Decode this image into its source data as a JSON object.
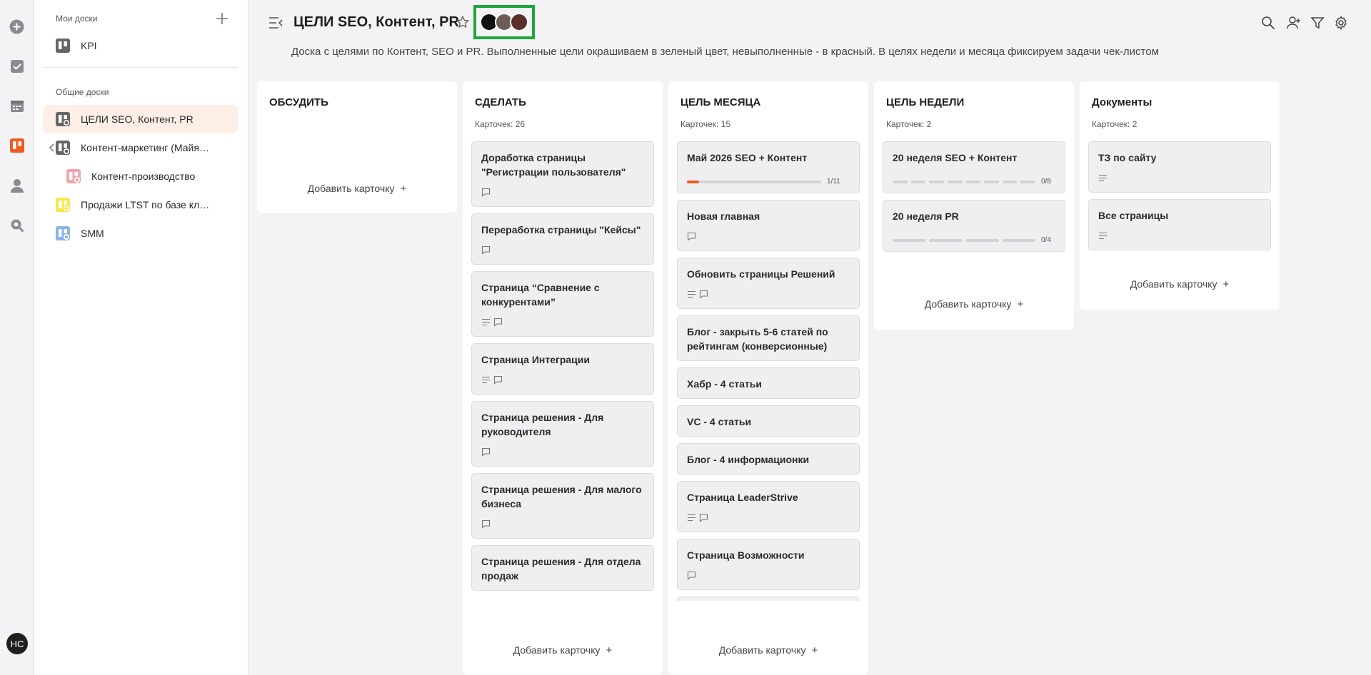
{
  "rail": {
    "icons": [
      "plus-circle-icon",
      "check-icon",
      "calendar-icon",
      "boards-icon",
      "user-icon",
      "search-globe-icon"
    ],
    "avatar_initials": "HC"
  },
  "sidebar": {
    "my_boards_label": "Мои доски",
    "shared_boards_label": "Общие доски",
    "my_boards": [
      {
        "label": "KPI",
        "color": "#666666"
      }
    ],
    "shared_boards": [
      {
        "label": "ЦЕЛИ SEO, Контент, PR",
        "color": "#666666",
        "active": true
      },
      {
        "label": "Контент-маркетинг (Майя…",
        "color": "#666666"
      },
      {
        "label": "Контент-производство",
        "color": "#f0a7ae"
      },
      {
        "label": "Продажи LTST по базе кл…",
        "color": "#f5e84a"
      },
      {
        "label": "SMM",
        "color": "#8ab4e8"
      }
    ]
  },
  "header": {
    "title": "ЦЕЛИ SEO, Контент, PR",
    "description": "Доска с целями по Контент, SEO и PR. Выполненные цели окрашиваем в зеленый цвет, невыполненные - в красный. В целях недели и месяца фиксируем задачи чек-листом",
    "highlight_color": "#1fa53d",
    "accent_color": "#f2591f"
  },
  "add_card_label": "Добавить карточку",
  "columns": [
    {
      "title": "ОБСУДИТЬ",
      "count": "",
      "cards": []
    },
    {
      "title": "СДЕЛАТЬ",
      "count": "Карточек: 26",
      "cards": [
        {
          "title": "Доработка страницы \"Регистрации пользователя\"",
          "icons": [
            "comment"
          ]
        },
        {
          "title": "Переработка страницы \"Кейсы\"",
          "icons": [
            "comment"
          ]
        },
        {
          "title": "Страница “Сравнение с конкурентами”",
          "icons": [
            "description",
            "comment"
          ]
        },
        {
          "title": "Страница Интеграции",
          "icons": [
            "description",
            "comment"
          ]
        },
        {
          "title": "Страница решения - Для руководителя",
          "icons": [
            "comment"
          ]
        },
        {
          "title": "Страница решения - Для малого бизнеса",
          "icons": [
            "comment"
          ]
        },
        {
          "title": "Страница решения - Для отдела продаж",
          "icons": []
        }
      ]
    },
    {
      "title": "ЦЕЛЬ МЕСЯЦА",
      "count": "Карточек: 15",
      "cards": [
        {
          "title": "Май 2026 SEO + Контент",
          "icons": [],
          "progress": {
            "done": 1,
            "total": 11,
            "label": "1/11"
          }
        },
        {
          "title": "Новая главная",
          "icons": [
            "comment"
          ]
        },
        {
          "title": "Обновить страницы Решений",
          "icons": [
            "description",
            "comment"
          ]
        },
        {
          "title": "Блог - закрыть 5-6 статей по рейтингам (конверсионные)",
          "icons": []
        },
        {
          "title": "Хабр - 4 статьи",
          "icons": []
        },
        {
          "title": "VC - 4 статьи",
          "icons": []
        },
        {
          "title": "Блог - 4 информационки",
          "icons": []
        },
        {
          "title": "Страница LeaderStrive",
          "icons": [
            "description",
            "comment"
          ]
        },
        {
          "title": "Страница Возможности",
          "icons": [
            "comment"
          ]
        }
      ]
    },
    {
      "title": "ЦЕЛЬ НЕДЕЛИ",
      "count": "Карточек: 2",
      "cards": [
        {
          "title": "20 неделя SEO + Контент",
          "icons": [],
          "segments": {
            "done": 0,
            "total": 8,
            "label": "0/8"
          }
        },
        {
          "title": "20 неделя PR",
          "icons": [],
          "segments": {
            "done": 0,
            "total": 4,
            "label": "0/4"
          }
        }
      ]
    },
    {
      "title": "Документы",
      "count": "Карточек: 2",
      "cards": [
        {
          "title": "ТЗ по сайту",
          "icons": [
            "description"
          ]
        },
        {
          "title": "Все страницы",
          "icons": [
            "description"
          ]
        }
      ]
    }
  ]
}
